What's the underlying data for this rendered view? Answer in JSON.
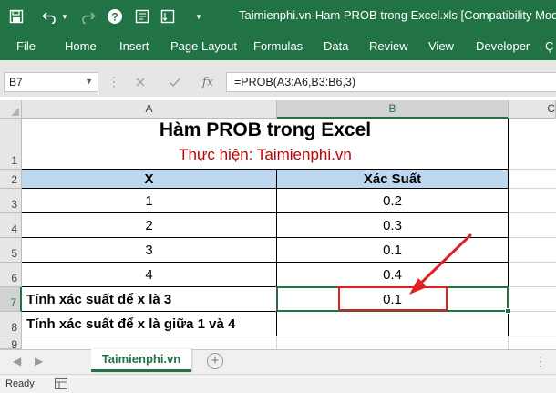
{
  "window": {
    "title": "Taimienphi.vn-Ham PROB trong Excel.xls  [Compatibility Mode]",
    "accent": "#217346"
  },
  "quick_access": [
    "save-icon",
    "undo-icon",
    "redo-icon",
    "help-icon",
    "form-icon",
    "customize-icon"
  ],
  "ribbon_tabs": [
    "File",
    "Home",
    "Insert",
    "Page Layout",
    "Formulas",
    "Data",
    "Review",
    "View",
    "Developer",
    "Ç"
  ],
  "formula_bar": {
    "name_box": "B7",
    "formula": "=PROB(A3:A6,B3:B6,3)",
    "fx_label": "fx"
  },
  "columns": [
    "A",
    "B",
    "C"
  ],
  "rows": [
    "1",
    "2",
    "3",
    "4",
    "5",
    "6",
    "7",
    "8",
    "9"
  ],
  "sheet": {
    "title": "Hàm PROB trong Excel",
    "subtitle": "Thực hiện: Taimienphi.vn",
    "subtitle_color": "#c00000",
    "header_fill": "#bdd7ee",
    "headers": [
      "X",
      "Xác Suất"
    ],
    "data": [
      {
        "x": "1",
        "p": "0.2"
      },
      {
        "x": "2",
        "p": "0.3"
      },
      {
        "x": "3",
        "p": "0.1"
      },
      {
        "x": "4",
        "p": "0.4"
      }
    ],
    "row7_label": "Tính xác suất để x là 3",
    "row7_value": "0.1",
    "row8_label": "Tính xác suất để x là giữa 1 và 4",
    "row8_value": ""
  },
  "sheet_tabs": {
    "active": "Taimienphi.vn",
    "add_label": "+"
  },
  "status": {
    "ready": "Ready"
  },
  "annotation": {
    "color": "#e02020"
  }
}
